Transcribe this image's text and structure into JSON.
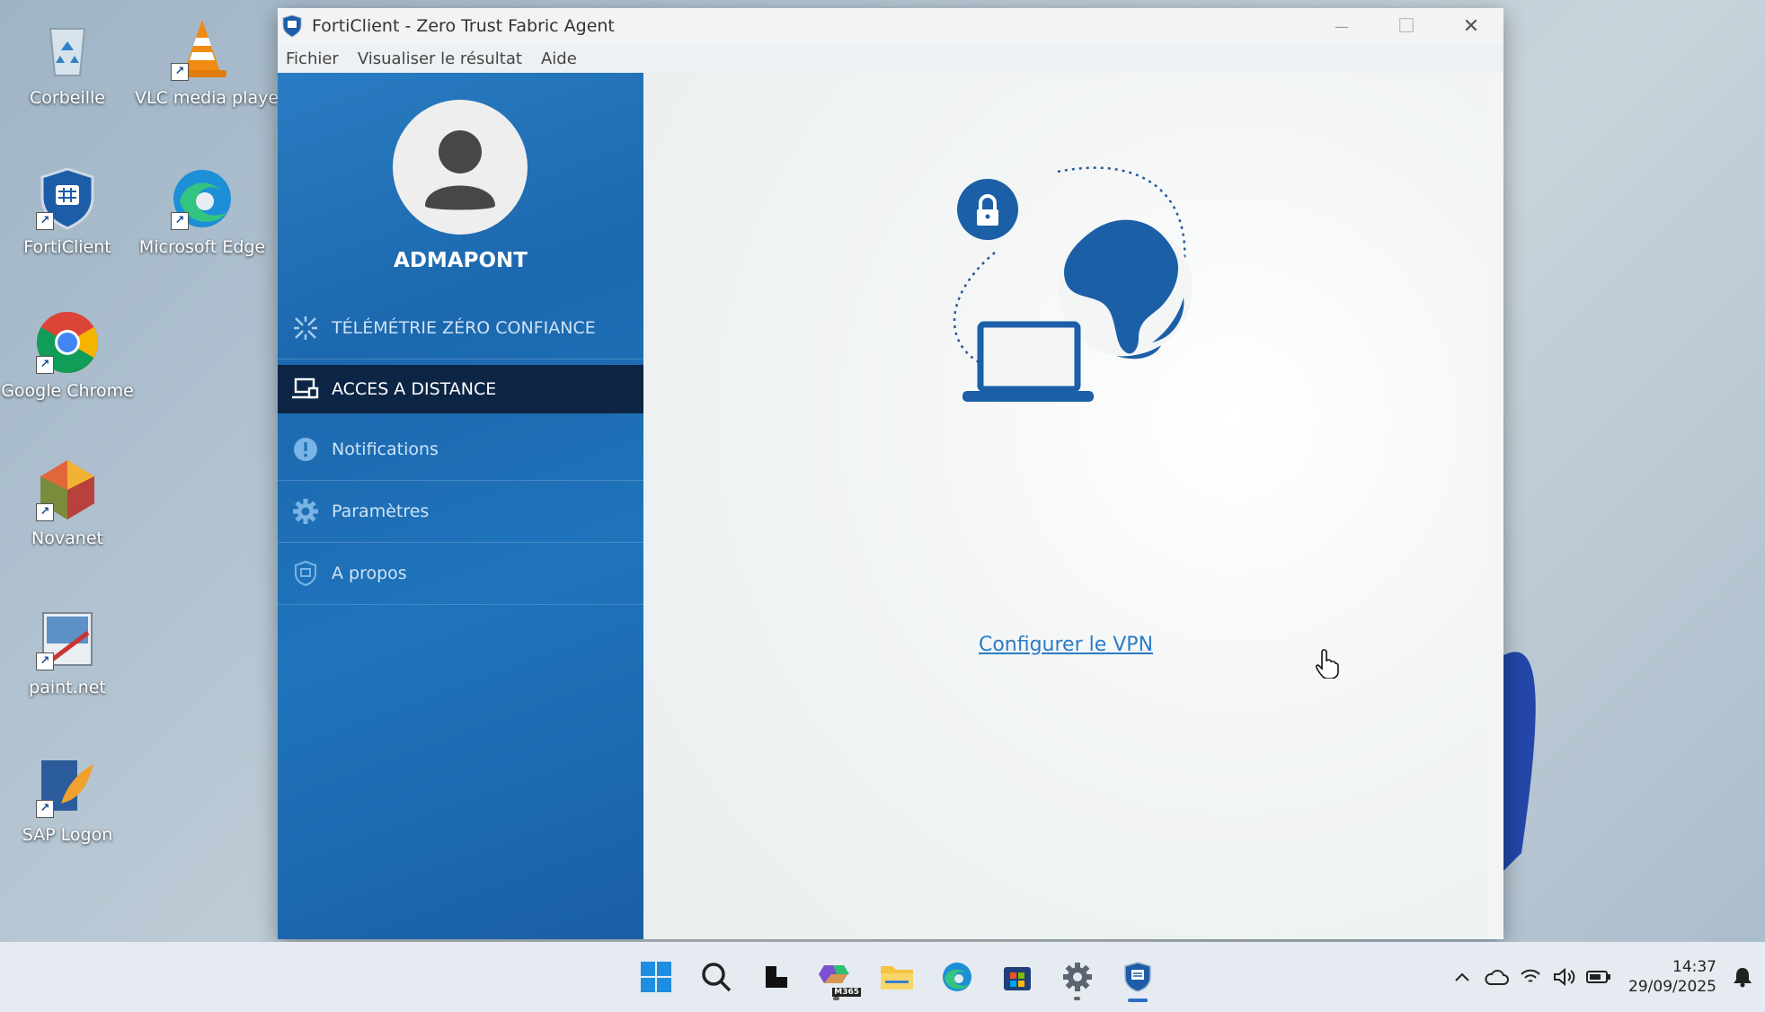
{
  "desktop": {
    "icons": [
      {
        "label": "Corbeille"
      },
      {
        "label": "VLC media player"
      },
      {
        "label": "FortiClient"
      },
      {
        "label": "Microsoft Edge"
      },
      {
        "label": "Google Chrome"
      },
      {
        "label": "Novanet"
      },
      {
        "label": "paint.net"
      },
      {
        "label": "SAP Logon"
      }
    ]
  },
  "window": {
    "title": "FortiClient - Zero Trust Fabric Agent",
    "menu": [
      "Fichier",
      "Visualiser le résultat",
      "Aide"
    ],
    "controls": {
      "minimize": "—",
      "maximize": "☐",
      "close": "✕"
    }
  },
  "sidebar": {
    "username": "ADMAPONT",
    "items": [
      {
        "label": "TÉLÉMÉTRIE ZÉRO CONFIANCE",
        "icon": "telemetry-icon",
        "active": false
      },
      {
        "label": "ACCES A DISTANCE",
        "icon": "remote-access-icon",
        "active": true
      },
      {
        "label": "Notifications",
        "icon": "alert-icon",
        "active": false
      },
      {
        "label": "Paramètres",
        "icon": "gear-icon",
        "active": false
      },
      {
        "label": "A propos",
        "icon": "shield-icon",
        "active": false
      }
    ]
  },
  "main": {
    "link_label": "Configurer le VPN"
  },
  "taskbar": {
    "apps": [
      "start-icon",
      "search-icon",
      "task-view-icon",
      "m365-icon",
      "file-explorer-icon",
      "edge-icon",
      "store-icon",
      "settings-icon",
      "forticlient-icon"
    ],
    "m365_badge": "M365",
    "clock": {
      "time": "14:37",
      "date": "29/09/2025"
    }
  },
  "colors": {
    "sidebar": "#1f6fb5",
    "active_nav": "#0d2545",
    "link": "#2a7bc6",
    "globe": "#1b5fa6"
  }
}
